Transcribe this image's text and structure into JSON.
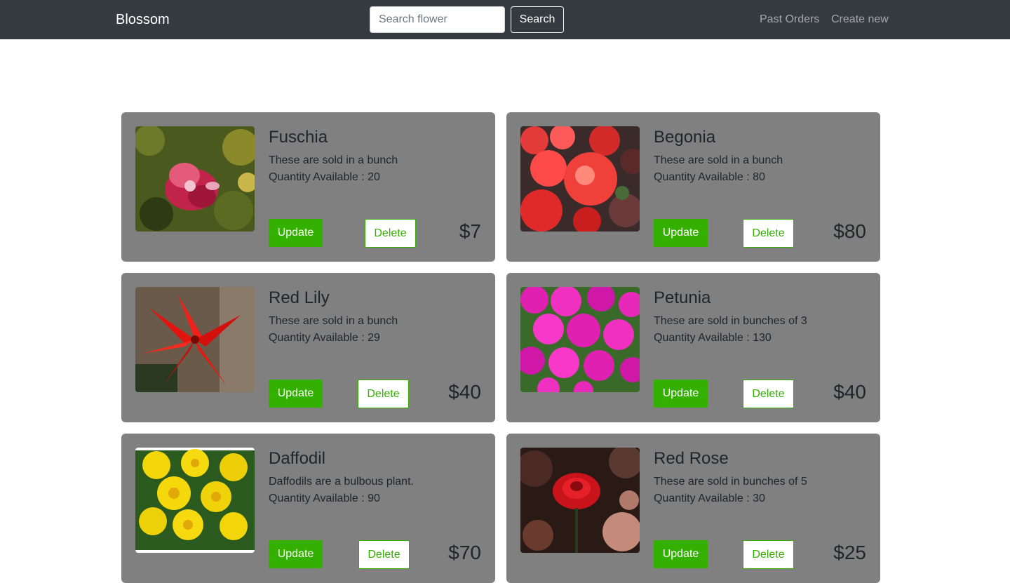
{
  "navbar": {
    "brand": "Blossom",
    "search_placeholder": "Search flower",
    "search_button": "Search",
    "links": [
      "Past Orders",
      "Create new"
    ]
  },
  "buttons": {
    "update": "Update",
    "delete": "Delete"
  },
  "products": [
    {
      "name": "Fuschia",
      "description": "These are sold in a bunch",
      "quantity": "Quantity Available : 20",
      "price": "$7",
      "image": "fuschia-photo"
    },
    {
      "name": "Begonia",
      "description": "These are sold in a bunch",
      "quantity": "Quantity Available : 80",
      "price": "$80",
      "image": "begonia-photo"
    },
    {
      "name": "Red Lily",
      "description": "These are sold in a bunch",
      "quantity": "Quantity Available : 29",
      "price": "$40",
      "image": "red-lily-photo"
    },
    {
      "name": "Petunia",
      "description": "These are sold in bunches of 3",
      "quantity": "Quantity Available : 130",
      "price": "$40",
      "image": "petunia-photo"
    },
    {
      "name": "Daffodil",
      "description": "Daffodils are a bulbous plant.",
      "quantity": "Quantity Available : 90",
      "price": "$70",
      "image": "daffodil-photo"
    },
    {
      "name": "Red Rose",
      "description": "These are sold in bunches of 5",
      "quantity": "Quantity Available : 30",
      "price": "$25",
      "image": "red-rose-photo"
    }
  ],
  "colors": {
    "navbar_bg": "#343a40",
    "card_bg": "#808080",
    "accent_green": "#33b000"
  }
}
